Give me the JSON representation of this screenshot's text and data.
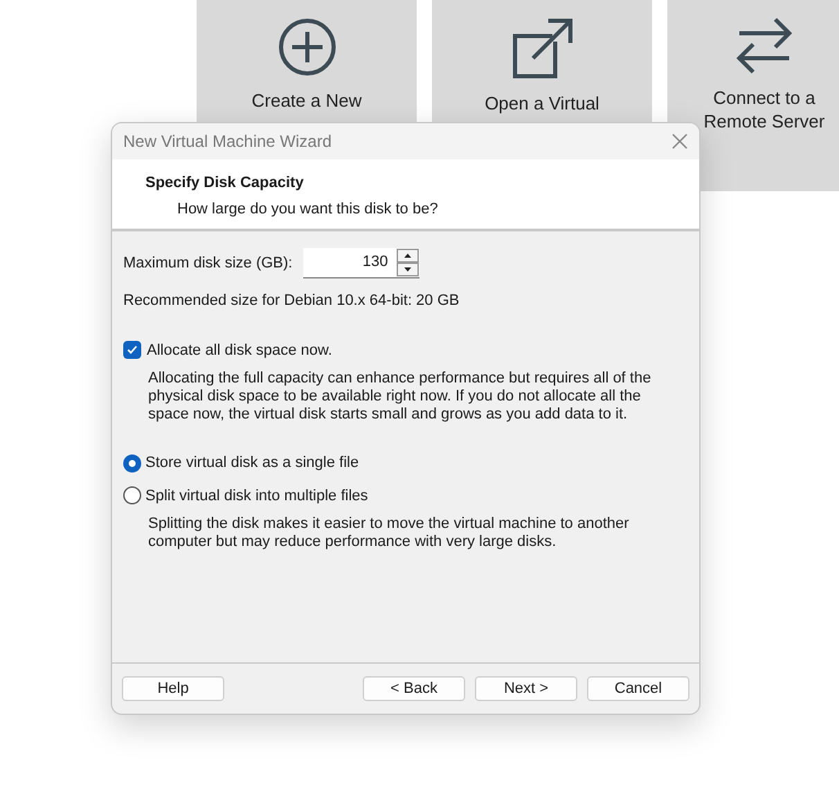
{
  "tiles": [
    {
      "kind": "plus",
      "lines": [
        "Create a New"
      ]
    },
    {
      "kind": "open",
      "lines": [
        "Open a Virtual"
      ]
    },
    {
      "kind": "swap",
      "lines": [
        "Connect to a",
        "Remote Server"
      ]
    }
  ],
  "dialog": {
    "title": "New Virtual Machine Wizard",
    "heading": "Specify Disk Capacity",
    "subheading": "How large do you want this disk to be?",
    "size_label": "Maximum disk size (GB):",
    "size_value": "130",
    "recommended": "Recommended size for Debian 10.x 64-bit: 20 GB",
    "allocate": {
      "label": "Allocate all disk space now.",
      "checked": true,
      "description": "Allocating the full capacity can enhance performance but requires all of the physical disk space to be available right now. If you do not allocate all the space now, the virtual disk starts small and grows as you add data to it."
    },
    "storage_options": [
      {
        "label": "Store virtual disk as a single file",
        "selected": true
      },
      {
        "label": "Split virtual disk into multiple files",
        "selected": false,
        "description": "Splitting the disk makes it easier to move the virtual machine to another computer but may reduce performance with very large disks."
      }
    ],
    "buttons": {
      "left": [
        "Help"
      ],
      "right": [
        "< Back",
        "Next >",
        "Cancel"
      ]
    }
  }
}
